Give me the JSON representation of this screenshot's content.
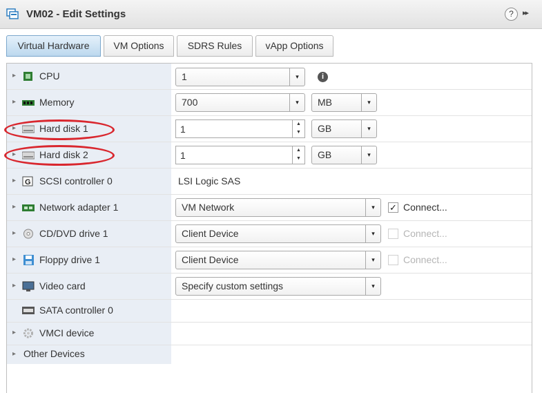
{
  "window": {
    "title": "VM02 - Edit Settings",
    "help": "?",
    "expand": "▸▸"
  },
  "tabs": [
    {
      "label": "Virtual Hardware"
    },
    {
      "label": "VM Options"
    },
    {
      "label": "SDRS Rules"
    },
    {
      "label": "vApp Options"
    }
  ],
  "rows": {
    "cpu": {
      "label": "CPU",
      "value": "1",
      "info": "i"
    },
    "memory": {
      "label": "Memory",
      "value": "700",
      "unit": "MB"
    },
    "disk1": {
      "label": "Hard disk 1",
      "value": "1",
      "unit": "GB"
    },
    "disk2": {
      "label": "Hard disk 2",
      "value": "1",
      "unit": "GB"
    },
    "scsi": {
      "label": "SCSI controller 0",
      "value": "LSI Logic SAS"
    },
    "network": {
      "label": "Network adapter 1",
      "value": "VM Network",
      "connect_label": "Connect...",
      "connect_checked": true
    },
    "cdrom": {
      "label": "CD/DVD drive 1",
      "value": "Client Device",
      "connect_label": "Connect...",
      "connect_checked": false
    },
    "floppy": {
      "label": "Floppy drive 1",
      "value": "Client Device",
      "connect_label": "Connect...",
      "connect_checked": false
    },
    "video": {
      "label": "Video card",
      "value": "Specify custom settings"
    },
    "sata": {
      "label": "SATA controller 0"
    },
    "vmci": {
      "label": "VMCI device"
    },
    "other": {
      "label": "Other Devices"
    }
  },
  "glyphs": {
    "arrow": "▸",
    "dropdown": "▾",
    "spin_up": "▲",
    "spin_down": "▼",
    "check": "✓"
  },
  "colors": {
    "highlight_ellipse": "#d9272e",
    "active_tab": "#bcd8ee",
    "left_column": "#e9eef5"
  }
}
